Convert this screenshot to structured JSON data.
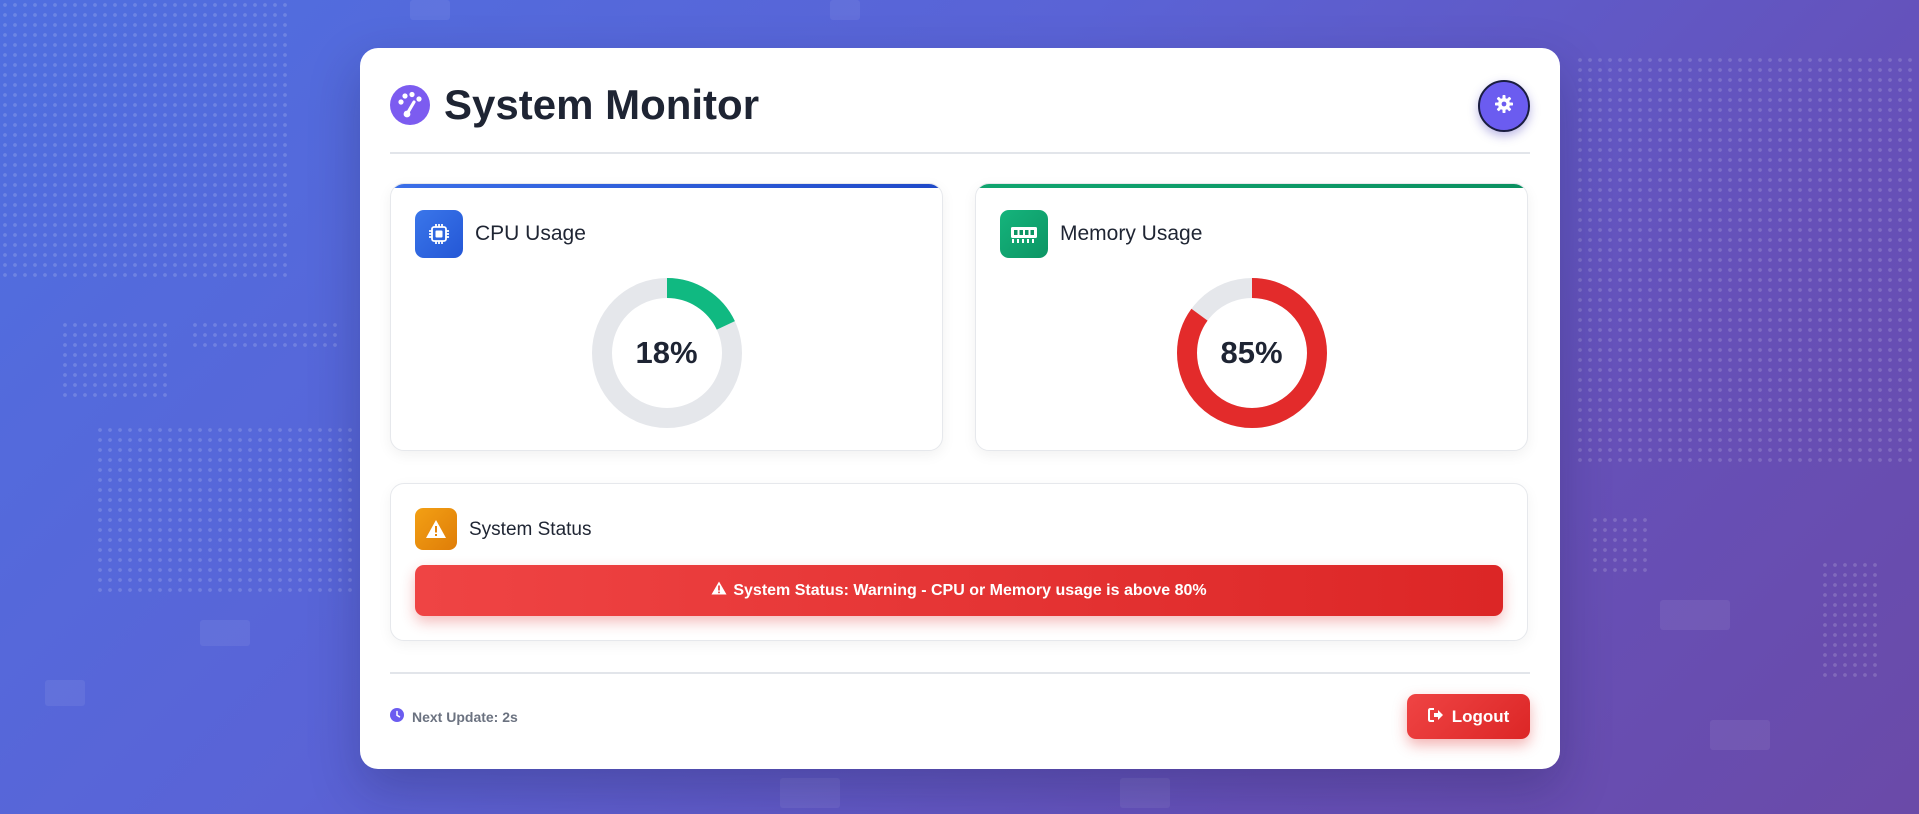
{
  "app": {
    "title": "System Monitor"
  },
  "icons": {
    "logo": "gauge-icon",
    "settings": "gear-icon",
    "cpu": "cpu-chip-icon",
    "memory": "memory-module-icon",
    "status": "warning-triangle-icon",
    "clock": "clock-icon",
    "logout": "sign-out-icon"
  },
  "metrics": {
    "cpu": {
      "label": "CPU Usage",
      "value": 18,
      "display": "18%",
      "color": "#10b981"
    },
    "memory": {
      "label": "Memory Usage",
      "value": 85,
      "display": "85%",
      "color": "#e32b2b"
    }
  },
  "status": {
    "label": "System Status",
    "message": "System Status: Warning - CPU or Memory usage is above 80%",
    "level": "warning"
  },
  "footer": {
    "next_update": "Next Update: 2s",
    "logout_label": "Logout"
  },
  "colors": {
    "accent": "#6b5cf0",
    "cpu_accent": "#2f63e0",
    "memory_accent": "#10a56f",
    "status_accent": "#ec8c0e",
    "danger": "#dc2626",
    "gauge_track": "#e5e7eb"
  }
}
